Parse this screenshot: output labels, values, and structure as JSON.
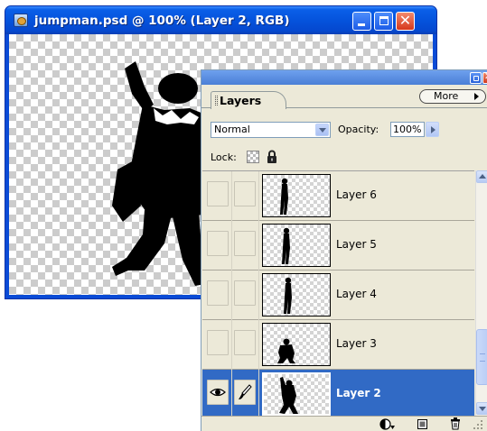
{
  "document": {
    "title": "jumpman.psd @ 100% (Layer 2, RGB)",
    "controls": [
      "minimize",
      "maximize",
      "close"
    ]
  },
  "layers_palette": {
    "tab_label": "Layers",
    "more_label": "More",
    "blend_mode": "Normal",
    "opacity_label": "Opacity:",
    "opacity_value": "100%",
    "lock_label": "Lock:",
    "layers": [
      {
        "name": "Layer 6",
        "visible": false,
        "selected": false,
        "thumbnail": "standing-figure"
      },
      {
        "name": "Layer 5",
        "visible": false,
        "selected": false,
        "thumbnail": "standing-figure"
      },
      {
        "name": "Layer 4",
        "visible": false,
        "selected": false,
        "thumbnail": "standing-figure"
      },
      {
        "name": "Layer 3",
        "visible": false,
        "selected": false,
        "thumbnail": "crouching-figure"
      },
      {
        "name": "Layer 2",
        "visible": true,
        "selected": true,
        "thumbnail": "jumping-figure"
      }
    ],
    "footer_icons": [
      "adjustment-layer-icon",
      "new-layer-icon",
      "trash-icon"
    ]
  },
  "colors": {
    "titlebar_blue": "#0553dc",
    "selection_blue": "#316ac5",
    "palette_bg": "#ece9d8"
  }
}
